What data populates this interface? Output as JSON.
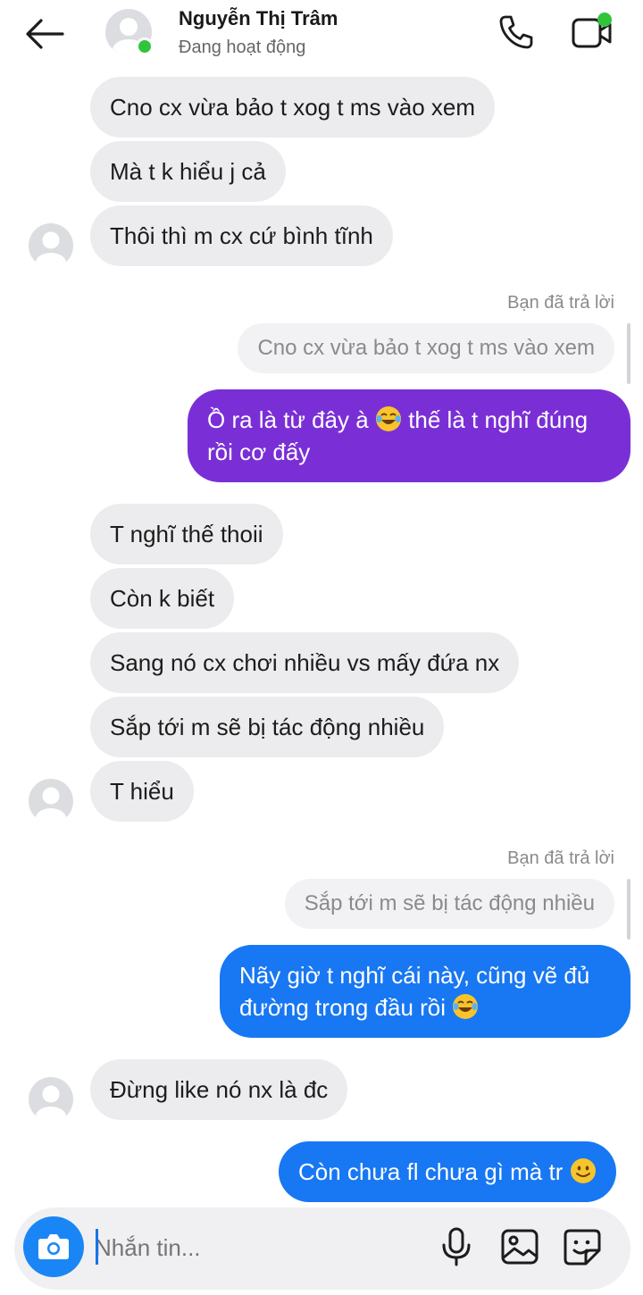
{
  "header": {
    "name": "Nguyễn Thị Trâm",
    "status": "Đang hoạt động"
  },
  "messages": {
    "m1": "Cno cx vừa bảo t xog t ms vào xem",
    "m2": "Mà t k hiểu j cả",
    "m3": "Thôi thì m cx cứ bình tĩnh",
    "reply1_label": "Bạn đã trả lời",
    "reply1_quote": "Cno cx vừa bảo t xog t ms vào xem",
    "m4_a": "Ồ ra là từ đây à",
    "m4_b": "thế là t nghĩ đúng rồi cơ đấy",
    "m5": "T nghĩ thế thoii",
    "m6": "Còn k biết",
    "m7": "Sang nó cx chơi nhiều vs mấy đứa nx",
    "m8": "Sắp tới m sẽ bị tác động nhiều",
    "m9": "T hiểu",
    "reply2_label": "Bạn đã trả lời",
    "reply2_quote": "Sắp tới m sẽ bị tác động nhiều",
    "m10_a": "Nãy giờ t nghĩ cái này, cũng vẽ đủ đường trong  đầu rồi",
    "m11": "Đừng like nó nx là đc",
    "m12": "Còn chưa fl chưa gì mà tr"
  },
  "composer": {
    "placeholder": "Nhắn tin..."
  },
  "colors": {
    "purple_bubble": "#7a2fd6",
    "blue_bubble": "#1877f2",
    "incoming_bubble": "#ececee",
    "online": "#31c43b"
  }
}
